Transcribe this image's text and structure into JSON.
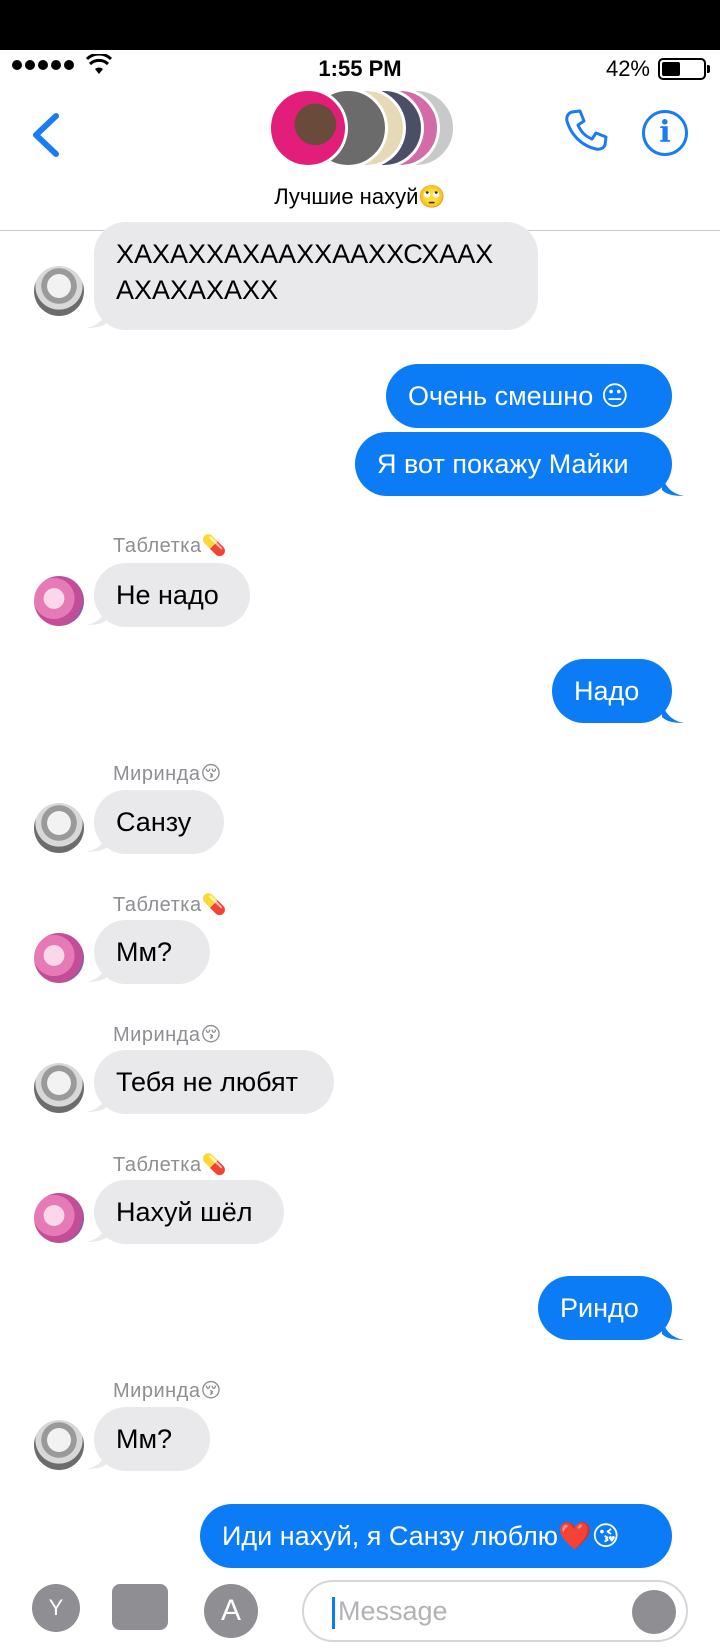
{
  "status_bar": {
    "time": "1:55 PM",
    "battery": "42%"
  },
  "header": {
    "group_name": "Лучшие нахуй🙄"
  },
  "messages": [
    {
      "type": "in",
      "text_line1": "ХАХАХХАХААХХААХХСХААХ",
      "text_line2": "АХАХАХАХХ"
    },
    {
      "type": "out",
      "text": "Очень смешно 😐"
    },
    {
      "type": "out",
      "text": "Я вот покажу Майки"
    },
    {
      "type": "in",
      "sender": "Таблетка💊",
      "text": "Не надо"
    },
    {
      "type": "out",
      "text": "Надо"
    },
    {
      "type": "in",
      "sender": "Миринда😚",
      "text": "Санзу"
    },
    {
      "type": "in",
      "sender": "Таблетка💊",
      "text": "Мм?"
    },
    {
      "type": "in",
      "sender": "Миринда😚",
      "text": "Тебя не любят"
    },
    {
      "type": "in",
      "sender": "Таблетка💊",
      "text": "Нахуй шёл"
    },
    {
      "type": "out",
      "text": "Риндо"
    },
    {
      "type": "in",
      "sender": "Миринда😚",
      "text": "Мм?"
    },
    {
      "type": "out",
      "text": "Иди нахуй, я Санзу люблю❤️😘"
    }
  ],
  "composer": {
    "app_button": "Y",
    "placeholder": "Message"
  },
  "colors": {
    "accent": "#0b7cf6",
    "incoming": "#e9e9eb"
  }
}
